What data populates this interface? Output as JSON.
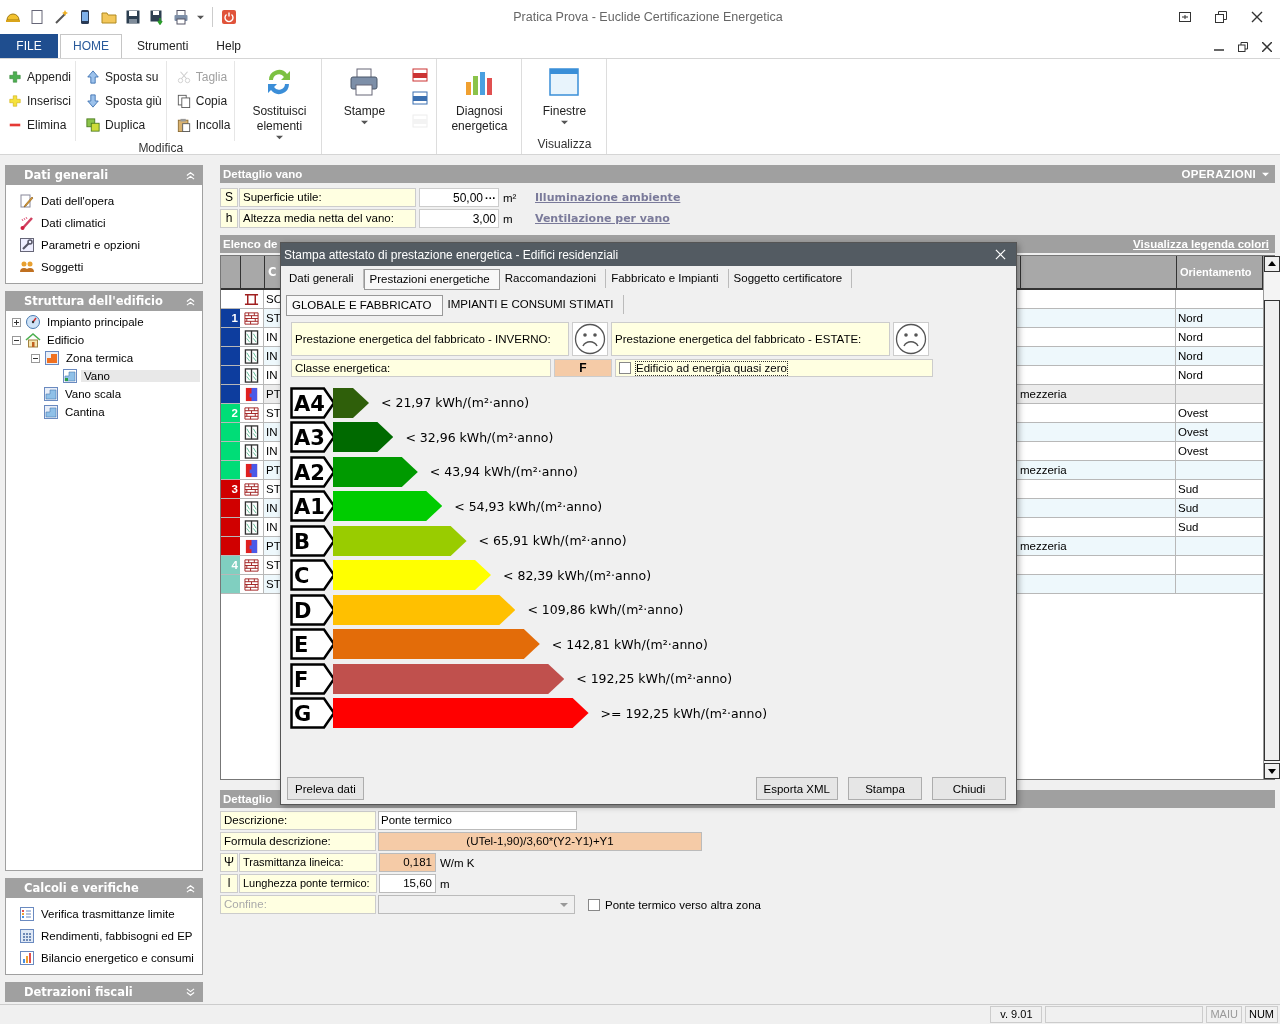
{
  "window": {
    "title": "Pratica Prova - Euclide Certificazione Energetica"
  },
  "ribbon": {
    "tabs": [
      {
        "label": "FILE",
        "kind": "file",
        "selected": false
      },
      {
        "label": "HOME",
        "kind": "tab",
        "selected": true
      },
      {
        "label": "Strumenti",
        "kind": "tab",
        "selected": false
      },
      {
        "label": "Help",
        "kind": "tab",
        "selected": false
      }
    ],
    "groups": [
      {
        "label": "Modifica",
        "columns": [
          {
            "kind": "small",
            "items": [
              {
                "label": "Appendi",
                "disabled": false
              },
              {
                "label": "Inserisci",
                "disabled": false
              },
              {
                "label": "Elimina",
                "disabled": false
              }
            ]
          },
          {
            "kind": "small",
            "items": [
              {
                "label": "Sposta su",
                "disabled": false
              },
              {
                "label": "Sposta giù",
                "disabled": false
              },
              {
                "label": "Duplica",
                "disabled": false
              }
            ]
          },
          {
            "kind": "small",
            "items": [
              {
                "label": "Taglia",
                "disabled": true
              },
              {
                "label": "Copia",
                "disabled": false
              },
              {
                "label": "Incolla",
                "disabled": false
              }
            ]
          },
          {
            "kind": "large",
            "label": "Sostituisci elementi",
            "dropdown": true
          }
        ]
      },
      {
        "columns": [
          {
            "kind": "large",
            "label": "Stampe",
            "dropdown": true
          },
          {
            "kind": "icons",
            "items": [
              {
                "disabled": false
              },
              {
                "disabled": false
              },
              {
                "disabled": true
              }
            ]
          }
        ]
      },
      {
        "columns": [
          {
            "kind": "large",
            "label": "Diagnosi energetica",
            "dropdown": false
          }
        ]
      },
      {
        "label": "Visualizza",
        "columns": [
          {
            "kind": "large",
            "label": "Finestre",
            "dropdown": true
          }
        ]
      }
    ]
  },
  "sidebar": {
    "panels": [
      {
        "title": "Dati generali",
        "kind": "list",
        "expanded": true,
        "items": [
          {
            "label": "Dati dell'opera"
          },
          {
            "label": "Dati climatici"
          },
          {
            "label": "Parametri e opzioni"
          },
          {
            "label": "Soggetti"
          }
        ]
      },
      {
        "title": "Struttura dell'edificio",
        "kind": "tree",
        "expanded": true,
        "tree": [
          {
            "label": "Impianto principale",
            "kind": "plant",
            "expanded": false,
            "selected": false,
            "has_children": true
          },
          {
            "label": "Edificio",
            "kind": "building",
            "expanded": true,
            "selected": false,
            "has_children": true,
            "children": [
              {
                "label": "Zona termica",
                "kind": "zone",
                "expanded": true,
                "selected": false,
                "has_children": true,
                "children": [
                  {
                    "label": "Vano",
                    "kind": "room",
                    "selected": true,
                    "has_children": false
                  }
                ]
              },
              {
                "label": "Vano scala",
                "kind": "room2",
                "selected": false,
                "has_children": false
              },
              {
                "label": "Cantina",
                "kind": "room2",
                "selected": false,
                "has_children": false
              }
            ]
          }
        ]
      },
      {
        "title": "Calcoli e verifiche",
        "kind": "list",
        "expanded": true,
        "items": [
          {
            "label": "Verifica trasmittanze limite"
          },
          {
            "label": "Rendimenti, fabbisogni ed EP"
          },
          {
            "label": "Bilancio energetico e consumi"
          }
        ]
      },
      {
        "title": "Detrazioni fiscali",
        "kind": "list",
        "expanded": false
      }
    ]
  },
  "vano": {
    "title": "Dettaglio vano",
    "operations": "OPERAZIONI",
    "fields": [
      {
        "symbol": "S",
        "label": "Superficie utile:",
        "value": "50,00",
        "button": "···",
        "unit": "m²",
        "link": "Illuminazione ambiente"
      },
      {
        "symbol": "h",
        "label": "Altezza media netta del vano:",
        "value": "3,00",
        "unit": "m",
        "link": "Ventilazione per vano"
      }
    ]
  },
  "list": {
    "title": "Elenco de",
    "legend_link": "Visualizza legenda colori",
    "columns": {
      "code": "C",
      "orientation": "Orientamento"
    },
    "rows": [
      {
        "kind": "slab",
        "code": "SO",
        "selected": false
      },
      {
        "group": "1",
        "color": "#0d3d9e",
        "kind": "wall",
        "code": "ST",
        "orientation": "Nord",
        "selected": false
      },
      {
        "color": "#0d3d9e",
        "kind": "window",
        "code": "IN",
        "orientation": "Nord",
        "selected": false
      },
      {
        "color": "#0d3d9e",
        "kind": "window",
        "code": "IN",
        "orientation": "Nord",
        "selected": false
      },
      {
        "color": "#0d3d9e",
        "kind": "window",
        "code": "IN",
        "orientation": "Nord",
        "selected": false
      },
      {
        "color": "#0d3d9e",
        "kind": "bridge",
        "code": "PT",
        "position": "mezzeria",
        "selected": true
      },
      {
        "group": "2",
        "color": "#00dd77",
        "kind": "wall",
        "code": "ST",
        "orientation": "Ovest",
        "selected": false
      },
      {
        "color": "#00dd77",
        "kind": "window",
        "code": "IN",
        "orientation": "Ovest",
        "selected": false
      },
      {
        "color": "#00dd77",
        "kind": "window",
        "code": "IN",
        "orientation": "Ovest",
        "selected": false
      },
      {
        "color": "#00dd77",
        "kind": "bridge",
        "code": "PT",
        "position": "mezzeria",
        "selected": false
      },
      {
        "group": "3",
        "color": "#d00000",
        "kind": "wall",
        "code": "ST",
        "orientation": "Sud",
        "selected": false
      },
      {
        "color": "#d00000",
        "kind": "window",
        "code": "IN",
        "orientation": "Sud",
        "selected": false
      },
      {
        "color": "#d00000",
        "kind": "window",
        "code": "IN",
        "orientation": "Sud",
        "selected": false
      },
      {
        "color": "#d00000",
        "kind": "bridge",
        "code": "PT",
        "position": "mezzeria",
        "selected": false
      },
      {
        "group": "4",
        "color": "#80cfc0",
        "kind": "wall",
        "code": "ST",
        "selected": false
      },
      {
        "color": "#80cfc0",
        "kind": "wall",
        "code": "ST",
        "selected": false
      }
    ]
  },
  "detail": {
    "title": "Dettaglio",
    "fields": [
      {
        "kind": "text",
        "label": "Descrizione:",
        "value": "Ponte termico"
      },
      {
        "kind": "formula",
        "label": "Formula descrizione:",
        "value": "(UTel-1,90)/3,60*(Y2-Y1)+Y1"
      },
      {
        "kind": "number",
        "symbol": "Ψ",
        "label": "Trasmittanza lineica:",
        "value": "0,181",
        "unit": "W/m K",
        "computed": true
      },
      {
        "kind": "number",
        "symbol": "l",
        "label": "Lunghezza ponte termico:",
        "value": "15,60",
        "unit": "m",
        "computed": false
      },
      {
        "kind": "select",
        "label": "Confine:",
        "disabled": true
      }
    ],
    "checkbox": {
      "label": "Ponte termico verso altra zona",
      "checked": false
    }
  },
  "dialog": {
    "title": "Stampa attestato di prestazione energetica - Edifici residenziali",
    "tabs": [
      {
        "label": "Dati generali",
        "selected": false
      },
      {
        "label": "Prestazioni energetiche",
        "selected": true
      },
      {
        "label": "Raccomandazioni",
        "selected": false
      },
      {
        "label": "Fabbricato e Impianti",
        "selected": false
      },
      {
        "label": "Soggetto certificatore",
        "selected": false
      }
    ],
    "subtabs": [
      {
        "label": "GLOBALE E FABBRICATO",
        "selected": true
      },
      {
        "label": "IMPIANTI E CONSUMI STIMATI",
        "selected": false
      }
    ],
    "winter": "Prestazione energetica del fabbricato - INVERNO:",
    "summer": "Prestazione energetica del fabbricato - ESTATE:",
    "class_label": "Classe energetica:",
    "class_value": "F",
    "nzeb": {
      "label": "Edificio ad energia quasi zero",
      "checked": false
    },
    "classes": [
      {
        "label": "A4",
        "color": "#2f5f0a",
        "range": "< 21,97 kWh/(m²·anno)"
      },
      {
        "label": "A3",
        "color": "#006a00",
        "range": "< 32,96 kWh/(m²·anno)"
      },
      {
        "label": "A2",
        "color": "#009a00",
        "range": "< 43,94 kWh/(m²·anno)"
      },
      {
        "label": "A1",
        "color": "#00cc00",
        "range": "< 54,93 kWh/(m²·anno)"
      },
      {
        "label": "B",
        "color": "#99cc00",
        "range": "< 65,91 kWh/(m²·anno)"
      },
      {
        "label": "C",
        "color": "#ffff00",
        "range": "< 82,39 kWh/(m²·anno)"
      },
      {
        "label": "D",
        "color": "#ffc000",
        "range": "< 109,86 kWh/(m²·anno)"
      },
      {
        "label": "E",
        "color": "#e36c09",
        "range": "< 142,81 kWh/(m²·anno)"
      },
      {
        "label": "F",
        "color": "#c0504d",
        "range": "< 192,25 kWh/(m²·anno)"
      },
      {
        "label": "G",
        "color": "#ff0000",
        "range": ">= 192,25 kWh/(m²·anno)"
      }
    ],
    "left_buttons": [
      "Preleva dati"
    ],
    "right_buttons": [
      "Esporta XML",
      "Stampa",
      "Chiudi"
    ]
  },
  "status_bar": {
    "version": "v. 9.01",
    "indicators": [
      {
        "label": "MAIU",
        "disabled": true
      },
      {
        "label": "NUM",
        "disabled": false
      }
    ]
  }
}
